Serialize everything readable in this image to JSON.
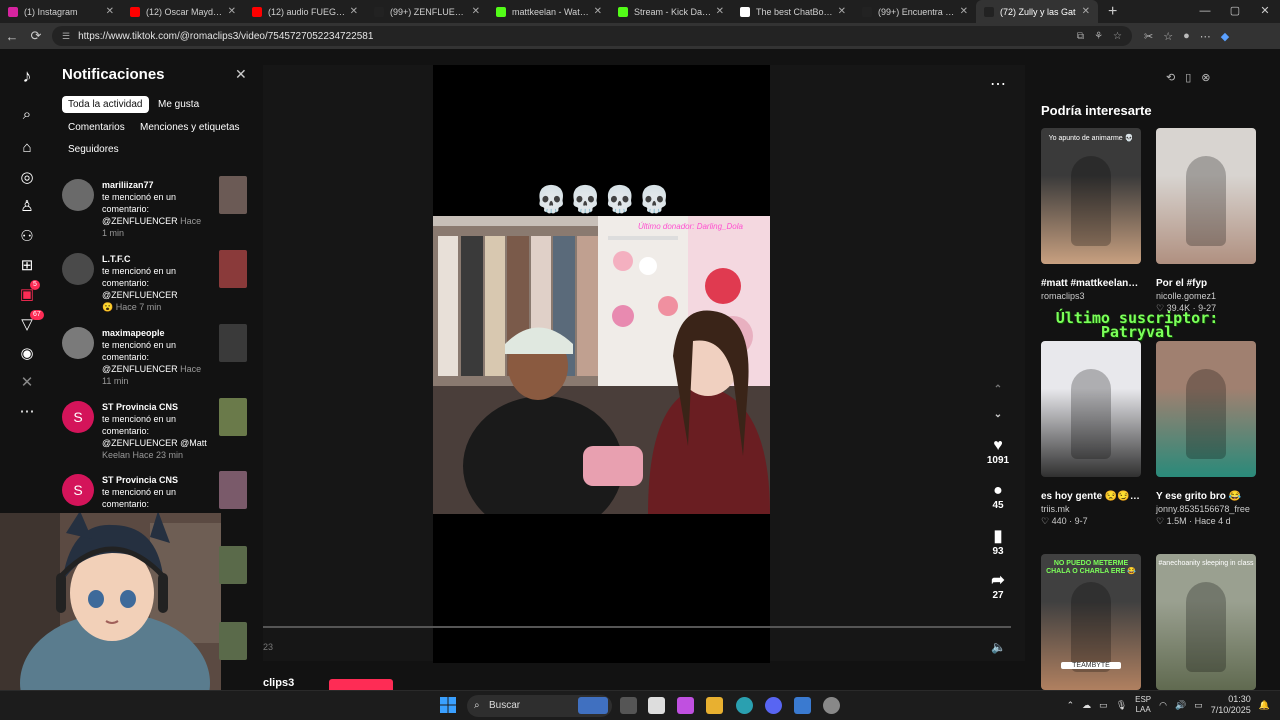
{
  "browser": {
    "tabs": [
      {
        "label": "(1) Instagram",
        "color": "#d6249f",
        "active": false
      },
      {
        "label": "(12) Oscar Maydon x F",
        "color": "#ff0000",
        "active": false
      },
      {
        "label": "(12) audio FUEGO, FUE",
        "color": "#ff0000",
        "active": false
      },
      {
        "label": "(99+) ZENFLUENCER (@",
        "color": "#222222",
        "active": false
      },
      {
        "label": "mattkeelan - Watch th",
        "color": "#53fc18",
        "active": false
      },
      {
        "label": "Stream - Kick Dashboa",
        "color": "#53fc18",
        "active": false
      },
      {
        "label": "The best ChatBot and",
        "color": "#ffffff",
        "active": false
      },
      {
        "label": "(99+) Encuentra 'QUE T",
        "color": "#222222",
        "active": false
      },
      {
        "label": "(72) Zully y las Gat",
        "color": "#222222",
        "active": true
      }
    ],
    "new_tab": "+",
    "url": "https://www.tiktok.com/@romaclips3/video/7545727052234722581"
  },
  "rail": {
    "messages_badge": "5",
    "activity_badge": "67"
  },
  "notifications": {
    "title": "Notificaciones",
    "close": "✕",
    "chips": [
      "Toda la actividad",
      "Me gusta",
      "Comentarios",
      "Menciones y etiquetas",
      "Seguidores"
    ],
    "items": [
      {
        "user": "mariliizan77",
        "line1": "te mencionó en un",
        "line2": "comentario:",
        "line3": "@ZENFLUENCER",
        "line3b": "Hace",
        "line4": "1 min",
        "avatar": "#6a6a6a",
        "thumb": "#6b5a55"
      },
      {
        "user": "L.T.F.C",
        "line1": "te mencionó en un",
        "line2": "comentario:",
        "line3": "@ZENFLUENCER",
        "line3b": "",
        "line4": "😮 Hace 7 min",
        "avatar": "#4a4a4a",
        "thumb": "#8a3a3a"
      },
      {
        "user": "maximapeople",
        "line1": "te mencionó en un",
        "line2": "comentario:",
        "line3": "@ZENFLUENCER",
        "line3b": "Hace",
        "line4": "11 min",
        "avatar": "#7a7a7a",
        "thumb": "#3a3a3a"
      },
      {
        "user": "ST Provincia CNS",
        "line1": "te mencionó en un",
        "line2": "comentario:",
        "line3": "@ZENFLUENCER @Matt",
        "line3b": "",
        "line4": "Keelan Hace 23 min",
        "avatar": "S",
        "thumb": "#6a7a4a"
      },
      {
        "user": "ST Provincia CNS",
        "line1": "te mencionó en un",
        "line2": "comentario:",
        "line3": "",
        "line3b": "",
        "line4": "",
        "avatar": "S",
        "thumb": "#7a5a6a"
      }
    ]
  },
  "video": {
    "overlay_emoji": "💀💀💀💀",
    "caption_overlay": "Último donador: Darling_Dola",
    "likes": "1091",
    "comments": "45",
    "saves": "93",
    "shares": "27",
    "time": "23",
    "handle": "clips3",
    "progress_fraction": 0.0
  },
  "recommendations": {
    "title": "Podría interesarte",
    "items": [
      {
        "caption": "#matt #mattkeelan #kickperu #kickclip...",
        "author": "romaclips3",
        "meta": "",
        "colors": [
          "#3a3a3a",
          "#c8a080"
        ]
      },
      {
        "caption": "Por el #fyp",
        "author": "nicolle.gomez1",
        "meta": "♡ 39.4K · 9-27",
        "colors": [
          "#d8d4d0",
          "#b09080"
        ]
      },
      {
        "caption": "es hoy gente 😒😏 (4pm hora peruana...",
        "author": "triis.mk",
        "meta": "♡ 440 · 9-7",
        "colors": [
          "#e8e8ec",
          "#303030"
        ]
      },
      {
        "caption": "Y ese grito bro 😂",
        "author": "jonny.8535156678_free",
        "meta": "♡ 1.5M · Hace 4 d",
        "colors": [
          "#a08070",
          "#2a8a7a"
        ]
      },
      {
        "caption": "",
        "author": "",
        "meta": "",
        "colors": [
          "#404040",
          "#b08060"
        ]
      },
      {
        "caption": "",
        "author": "",
        "meta": "",
        "colors": [
          "#9aa090",
          "#606a50"
        ]
      }
    ],
    "overlay_line1": "Último suscriptor:",
    "overlay_line2": "Patryval",
    "thumb_text1": "Yo apunto de animarme 💀",
    "thumb_text3": "NO PUEDO METERME CHALA O CHARLA ERE 😂",
    "thumb_text4": "#anechoanity sleeping in class",
    "thumb_brand": "TEAMBYTE"
  },
  "taskbar": {
    "search": "Buscar",
    "lang1": "ESP",
    "lang2": "LAA",
    "time": "01:30",
    "date": "7/10/2025"
  }
}
